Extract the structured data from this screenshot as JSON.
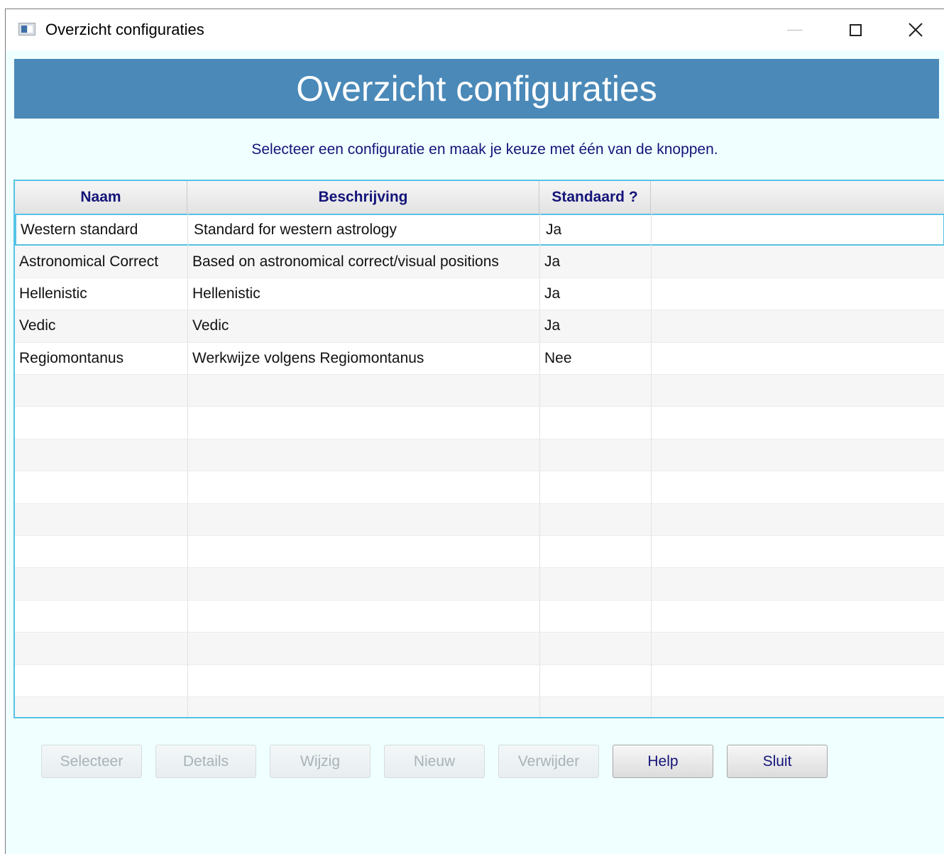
{
  "window": {
    "title": "Overzicht configuraties",
    "controls": {
      "minimize": "—",
      "maximize": "☐",
      "close": "✕"
    }
  },
  "banner": {
    "title": "Overzicht configuraties"
  },
  "instruction": "Selecteer een configuratie en maak je keuze met één van de knoppen.",
  "table": {
    "columns": [
      "Naam",
      "Beschrijving",
      "Standaard ?",
      ""
    ],
    "rows": [
      {
        "naam": "Western standard",
        "beschrijving": "Standard for western astrology",
        "standaard": "Ja"
      },
      {
        "naam": "Astronomical Correct",
        "beschrijving": "Based on astronomical correct/visual positions",
        "standaard": "Ja"
      },
      {
        "naam": "Hellenistic",
        "beschrijving": "Hellenistic",
        "standaard": "Ja"
      },
      {
        "naam": "Vedic",
        "beschrijving": "Vedic",
        "standaard": "Ja"
      },
      {
        "naam": "Regiomontanus",
        "beschrijving": "Werkwijze volgens Regiomontanus",
        "standaard": "Nee"
      }
    ],
    "selected_row": 0
  },
  "buttons": [
    {
      "label": "Selecteer",
      "enabled": false
    },
    {
      "label": "Details",
      "enabled": false
    },
    {
      "label": "Wijzig",
      "enabled": false
    },
    {
      "label": "Nieuw",
      "enabled": false
    },
    {
      "label": "Verwijder",
      "enabled": false
    },
    {
      "label": "Help",
      "enabled": true
    },
    {
      "label": "Sluit",
      "enabled": true
    }
  ],
  "colors": {
    "banner": "#4a89b8",
    "window_background": "#f0ffff",
    "selection_border": "#55c3e6",
    "header_text": "#14147a"
  }
}
